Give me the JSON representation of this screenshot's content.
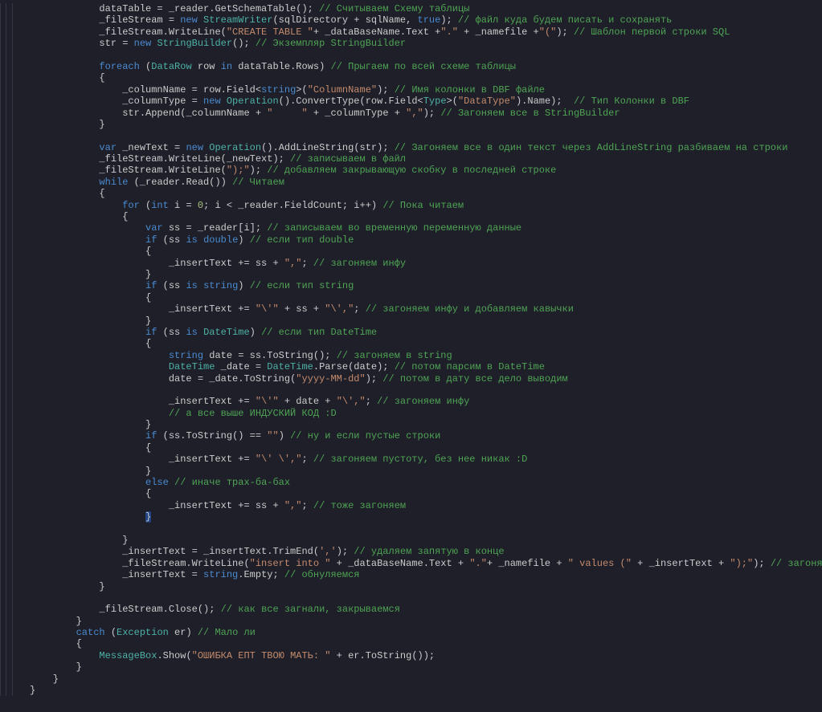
{
  "code": {
    "lines": [
      [
        [
          "    dataTable = _reader.",
          "id"
        ],
        [
          "GetSchemaTable",
          "fn"
        ],
        [
          "(); ",
          "id"
        ],
        [
          "// Считываем Схему таблицы",
          "cm"
        ]
      ],
      [
        [
          "    _fileStream = ",
          "id"
        ],
        [
          "new",
          "kw"
        ],
        [
          " ",
          "id"
        ],
        [
          "StreamWriter",
          "type"
        ],
        [
          "(sqlDirectory + sqlName, ",
          "id"
        ],
        [
          "true",
          "kw"
        ],
        [
          "); ",
          "id"
        ],
        [
          "// файл куда будем писать и сохранять",
          "cm"
        ]
      ],
      [
        [
          "    _fileStream.",
          "id"
        ],
        [
          "WriteLine",
          "fn"
        ],
        [
          "(",
          "id"
        ],
        [
          "\"CREATE TABLE \"",
          "str"
        ],
        [
          "+ _dataBaseName.Text +",
          "id"
        ],
        [
          "\".\"",
          "str"
        ],
        [
          " + _namefile +",
          "id"
        ],
        [
          "\"(\"",
          "str"
        ],
        [
          "); ",
          "id"
        ],
        [
          "// Шаблон первой строки SQL",
          "cm"
        ]
      ],
      [
        [
          "    str = ",
          "id"
        ],
        [
          "new",
          "kw"
        ],
        [
          " ",
          "id"
        ],
        [
          "StringBuilder",
          "type"
        ],
        [
          "(); ",
          "id"
        ],
        [
          "// Экземпляр StringBuilder",
          "cm"
        ]
      ],
      [
        [
          "",
          "id"
        ]
      ],
      [
        [
          "    ",
          "id"
        ],
        [
          "foreach",
          "kw"
        ],
        [
          " (",
          "id"
        ],
        [
          "DataRow",
          "type"
        ],
        [
          " row ",
          "id"
        ],
        [
          "in",
          "kw"
        ],
        [
          " dataTable.Rows) ",
          "id"
        ],
        [
          "// Прыгаем по всей схеме таблицы",
          "cm"
        ]
      ],
      [
        [
          "    {",
          "id"
        ]
      ],
      [
        [
          "        _columnName = row.",
          "id"
        ],
        [
          "Field",
          "fn"
        ],
        [
          "<",
          "id"
        ],
        [
          "string",
          "kw"
        ],
        [
          ">(",
          "id"
        ],
        [
          "\"ColumnName\"",
          "str"
        ],
        [
          "); ",
          "id"
        ],
        [
          "// Имя колонки в DBF файле",
          "cm"
        ]
      ],
      [
        [
          "        _columnType = ",
          "id"
        ],
        [
          "new",
          "kw"
        ],
        [
          " ",
          "id"
        ],
        [
          "Operation",
          "type"
        ],
        [
          "().",
          "id"
        ],
        [
          "ConvertType",
          "fn"
        ],
        [
          "(row.",
          "id"
        ],
        [
          "Field",
          "fn"
        ],
        [
          "<",
          "id"
        ],
        [
          "Type",
          "type"
        ],
        [
          ">(",
          "id"
        ],
        [
          "\"DataType\"",
          "str"
        ],
        [
          ").Name);  ",
          "id"
        ],
        [
          "// Тип Колонки в DBF",
          "cm"
        ]
      ],
      [
        [
          "        str.",
          "id"
        ],
        [
          "Append",
          "fn"
        ],
        [
          "(_columnName + ",
          "id"
        ],
        [
          "\"     \"",
          "str"
        ],
        [
          " + _columnType + ",
          "id"
        ],
        [
          "\",\"",
          "str"
        ],
        [
          "); ",
          "id"
        ],
        [
          "// Загоняем все в StringBuilder",
          "cm"
        ]
      ],
      [
        [
          "    }",
          "id"
        ]
      ],
      [
        [
          "",
          "id"
        ]
      ],
      [
        [
          "    ",
          "id"
        ],
        [
          "var",
          "kw"
        ],
        [
          " _newText = ",
          "id"
        ],
        [
          "new",
          "kw"
        ],
        [
          " ",
          "id"
        ],
        [
          "Operation",
          "type"
        ],
        [
          "().",
          "id"
        ],
        [
          "AddLineString",
          "fn"
        ],
        [
          "(str); ",
          "id"
        ],
        [
          "// Загоняем все в один текст через AddLineString разбиваем на строки",
          "cm"
        ]
      ],
      [
        [
          "    _fileStream.",
          "id"
        ],
        [
          "WriteLine",
          "fn"
        ],
        [
          "(_newText); ",
          "id"
        ],
        [
          "// записываем в файл",
          "cm"
        ]
      ],
      [
        [
          "    _fileStream.",
          "id"
        ],
        [
          "WriteLine",
          "fn"
        ],
        [
          "(",
          "id"
        ],
        [
          "\");\"",
          "str"
        ],
        [
          "); ",
          "id"
        ],
        [
          "// добавляем закрывающую скобку в последней строке",
          "cm"
        ]
      ],
      [
        [
          "    ",
          "id"
        ],
        [
          "while",
          "kw"
        ],
        [
          " (_reader.",
          "id"
        ],
        [
          "Read",
          "fn"
        ],
        [
          "()) ",
          "id"
        ],
        [
          "// Читаем",
          "cm"
        ]
      ],
      [
        [
          "    {",
          "id"
        ]
      ],
      [
        [
          "        ",
          "id"
        ],
        [
          "for",
          "kw"
        ],
        [
          " (",
          "id"
        ],
        [
          "int",
          "kw"
        ],
        [
          " i = ",
          "id"
        ],
        [
          "0",
          "num"
        ],
        [
          "; i < _reader.FieldCount; i++) ",
          "id"
        ],
        [
          "// Пока читаем",
          "cm"
        ]
      ],
      [
        [
          "        {",
          "id"
        ]
      ],
      [
        [
          "            ",
          "id"
        ],
        [
          "var",
          "kw"
        ],
        [
          " ss = _reader[i]; ",
          "id"
        ],
        [
          "// записываем во временную переменную данные",
          "cm"
        ]
      ],
      [
        [
          "            ",
          "id"
        ],
        [
          "if",
          "kw"
        ],
        [
          " (ss ",
          "id"
        ],
        [
          "is",
          "kw"
        ],
        [
          " ",
          "id"
        ],
        [
          "double",
          "kw"
        ],
        [
          ") ",
          "id"
        ],
        [
          "// если тип double",
          "cm"
        ]
      ],
      [
        [
          "            {",
          "id"
        ]
      ],
      [
        [
          "                _insertText += ss + ",
          "id"
        ],
        [
          "\",\"",
          "str"
        ],
        [
          "; ",
          "id"
        ],
        [
          "// загоняем инфу",
          "cm"
        ]
      ],
      [
        [
          "            }",
          "id"
        ]
      ],
      [
        [
          "            ",
          "id"
        ],
        [
          "if",
          "kw"
        ],
        [
          " (ss ",
          "id"
        ],
        [
          "is",
          "kw"
        ],
        [
          " ",
          "id"
        ],
        [
          "string",
          "kw"
        ],
        [
          ") ",
          "id"
        ],
        [
          "// если тип string",
          "cm"
        ]
      ],
      [
        [
          "            {",
          "id"
        ]
      ],
      [
        [
          "                _insertText += ",
          "id"
        ],
        [
          "\"\\'\"",
          "str"
        ],
        [
          " + ss + ",
          "id"
        ],
        [
          "\"\\',\"",
          "str"
        ],
        [
          "; ",
          "id"
        ],
        [
          "// загоняем инфу и добавляем кавычки",
          "cm"
        ]
      ],
      [
        [
          "            }",
          "id"
        ]
      ],
      [
        [
          "            ",
          "id"
        ],
        [
          "if",
          "kw"
        ],
        [
          " (ss ",
          "id"
        ],
        [
          "is",
          "kw"
        ],
        [
          " ",
          "id"
        ],
        [
          "DateTime",
          "type"
        ],
        [
          ") ",
          "id"
        ],
        [
          "// если тип DateTime",
          "cm"
        ]
      ],
      [
        [
          "            {",
          "id"
        ]
      ],
      [
        [
          "                ",
          "id"
        ],
        [
          "string",
          "kw"
        ],
        [
          " date = ss.",
          "id"
        ],
        [
          "ToString",
          "fn"
        ],
        [
          "(); ",
          "id"
        ],
        [
          "// загоняем в string",
          "cm"
        ]
      ],
      [
        [
          "                ",
          "id"
        ],
        [
          "DateTime",
          "type"
        ],
        [
          " _date = ",
          "id"
        ],
        [
          "DateTime",
          "type"
        ],
        [
          ".",
          "id"
        ],
        [
          "Parse",
          "fn"
        ],
        [
          "(date); ",
          "id"
        ],
        [
          "// потом парсим в DateTime",
          "cm"
        ]
      ],
      [
        [
          "                date = _date.",
          "id"
        ],
        [
          "ToString",
          "fn"
        ],
        [
          "(",
          "id"
        ],
        [
          "\"yyyy-MM-dd\"",
          "str"
        ],
        [
          "); ",
          "id"
        ],
        [
          "// потом в дату все дело выводим",
          "cm"
        ]
      ],
      [
        [
          "",
          "id"
        ]
      ],
      [
        [
          "                _insertText += ",
          "id"
        ],
        [
          "\"\\'\"",
          "str"
        ],
        [
          " + date + ",
          "id"
        ],
        [
          "\"\\',\"",
          "str"
        ],
        [
          "; ",
          "id"
        ],
        [
          "// загоняем инфу",
          "cm"
        ]
      ],
      [
        [
          "                ",
          "id"
        ],
        [
          "// а все выше ИНДУСКИЙ КОД :D",
          "cm"
        ]
      ],
      [
        [
          "            }",
          "id"
        ]
      ],
      [
        [
          "            ",
          "id"
        ],
        [
          "if",
          "kw"
        ],
        [
          " (ss.",
          "id"
        ],
        [
          "ToString",
          "fn"
        ],
        [
          "() == ",
          "id"
        ],
        [
          "\"\"",
          "str"
        ],
        [
          ") ",
          "id"
        ],
        [
          "// ну и если пустые строки",
          "cm"
        ]
      ],
      [
        [
          "            {",
          "id"
        ]
      ],
      [
        [
          "                _insertText += ",
          "id"
        ],
        [
          "\"\\' \\',\"",
          "str"
        ],
        [
          "; ",
          "id"
        ],
        [
          "// загоняем пустоту, без нее никак :D",
          "cm"
        ]
      ],
      [
        [
          "            }",
          "id"
        ]
      ],
      [
        [
          "            ",
          "id"
        ],
        [
          "else",
          "kw"
        ],
        [
          " ",
          "id"
        ],
        [
          "// иначе трах-ба-бах",
          "cm"
        ]
      ],
      [
        [
          "            {",
          "id"
        ]
      ],
      [
        [
          "                _insertText += ss + ",
          "id"
        ],
        [
          "\",\"",
          "str"
        ],
        [
          "; ",
          "id"
        ],
        [
          "// тоже загоняем",
          "cm"
        ]
      ],
      [
        [
          "            ",
          "id"
        ],
        [
          "}",
          "sel"
        ]
      ],
      [
        [
          "",
          "id"
        ]
      ],
      [
        [
          "        }",
          "id"
        ]
      ],
      [
        [
          "        _insertText = _insertText.",
          "id"
        ],
        [
          "TrimEnd",
          "fn"
        ],
        [
          "(",
          "id"
        ],
        [
          "','",
          "str"
        ],
        [
          "); ",
          "id"
        ],
        [
          "// удаляем запятую в конце",
          "cm"
        ]
      ],
      [
        [
          "        _fileStream.",
          "id"
        ],
        [
          "WriteLine",
          "fn"
        ],
        [
          "(",
          "id"
        ],
        [
          "\"insert into \"",
          "str"
        ],
        [
          " + _dataBaseName.Text + ",
          "id"
        ],
        [
          "\".\"",
          "str"
        ],
        [
          "+ _namefile + ",
          "id"
        ],
        [
          "\" values (\"",
          "str"
        ],
        [
          " + _insertText + ",
          "id"
        ],
        [
          "\");\"",
          "str"
        ],
        [
          "); ",
          "id"
        ],
        [
          "// загоняем в наш документ",
          "cm"
        ]
      ],
      [
        [
          "        _insertText = ",
          "id"
        ],
        [
          "string",
          "kw"
        ],
        [
          ".Empty; ",
          "id"
        ],
        [
          "// обнуляемся",
          "cm"
        ]
      ],
      [
        [
          "    }",
          "id"
        ]
      ],
      [
        [
          "",
          "id"
        ]
      ],
      [
        [
          "    _fileStream.",
          "id"
        ],
        [
          "Close",
          "fn"
        ],
        [
          "(); ",
          "id"
        ],
        [
          "// как все загнали, закрываемся",
          "cm"
        ]
      ],
      [
        [
          "}",
          "id"
        ]
      ],
      [
        [
          "",
          "id"
        ],
        [
          "catch",
          "kw"
        ],
        [
          " (",
          "id"
        ],
        [
          "Exception",
          "type"
        ],
        [
          " er) ",
          "id"
        ],
        [
          "// Мало ли",
          "cm"
        ]
      ],
      [
        [
          "{",
          "id"
        ]
      ],
      [
        [
          "    ",
          "id"
        ],
        [
          "MessageBox",
          "type"
        ],
        [
          ".",
          "id"
        ],
        [
          "Show",
          "fn"
        ],
        [
          "(",
          "id"
        ],
        [
          "\"ОШИБКА ЕПТ ТВОЮ МАТЬ: \"",
          "str"
        ],
        [
          " + er.",
          "id"
        ],
        [
          "ToString",
          "fn"
        ],
        [
          "());",
          "id"
        ]
      ],
      [
        [
          "}",
          "id"
        ]
      ]
    ],
    "trailing": [
      "    }",
      "}"
    ],
    "base_indent": "        "
  }
}
